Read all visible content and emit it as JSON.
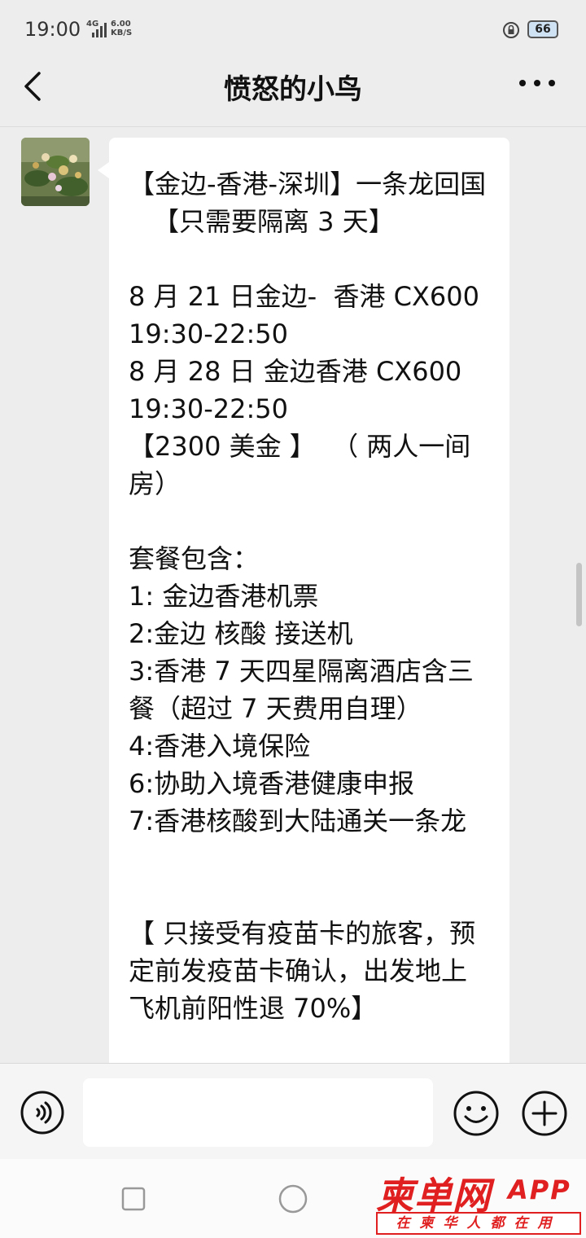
{
  "status_bar": {
    "time": "19:00",
    "network": "4G",
    "speed_value": "6.00",
    "speed_unit": "KB/S",
    "battery": "66"
  },
  "nav": {
    "title": "愤怒的小鸟"
  },
  "message": {
    "lines": [
      "【金边-香港-深圳】一条龙回国",
      "【只需要隔离 3 天】",
      "",
      "8 月 21 日金边-  香港 CX600",
      "19:30-22:50",
      "8 月 28 日 金边香港 CX600",
      "19:30-22:50",
      "【2300 美金 】  （ 两人一间",
      "房）",
      "",
      "套餐包含：",
      "1: 金边香港机票",
      "2:金边 核酸 接送机",
      "3:香港 7 天四星隔离酒店含三",
      "餐（超过 7 天费用自理）",
      "4:香港入境保险",
      "6:协助入境香港健康申报",
      "7:香港核酸到大陆通关一条龙",
      "",
      "",
      "【 只接受有疫苗卡的旅客，预",
      "定前发疫苗卡确认，出发地上",
      "飞机前阳性退 70%】"
    ]
  },
  "input": {
    "value": ""
  },
  "watermark": {
    "brand": "柬单网",
    "app": "APP",
    "slogan": "在柬华人都在用"
  },
  "colors": {
    "background": "#ededed",
    "bubble": "#ffffff",
    "watermark_red": "#e02020"
  },
  "icons": [
    "signal-icon",
    "rotate-lock-icon",
    "battery-icon",
    "back-icon",
    "more-icon",
    "voice-icon",
    "emoji-icon",
    "add-icon",
    "recent-apps-icon",
    "home-icon"
  ]
}
